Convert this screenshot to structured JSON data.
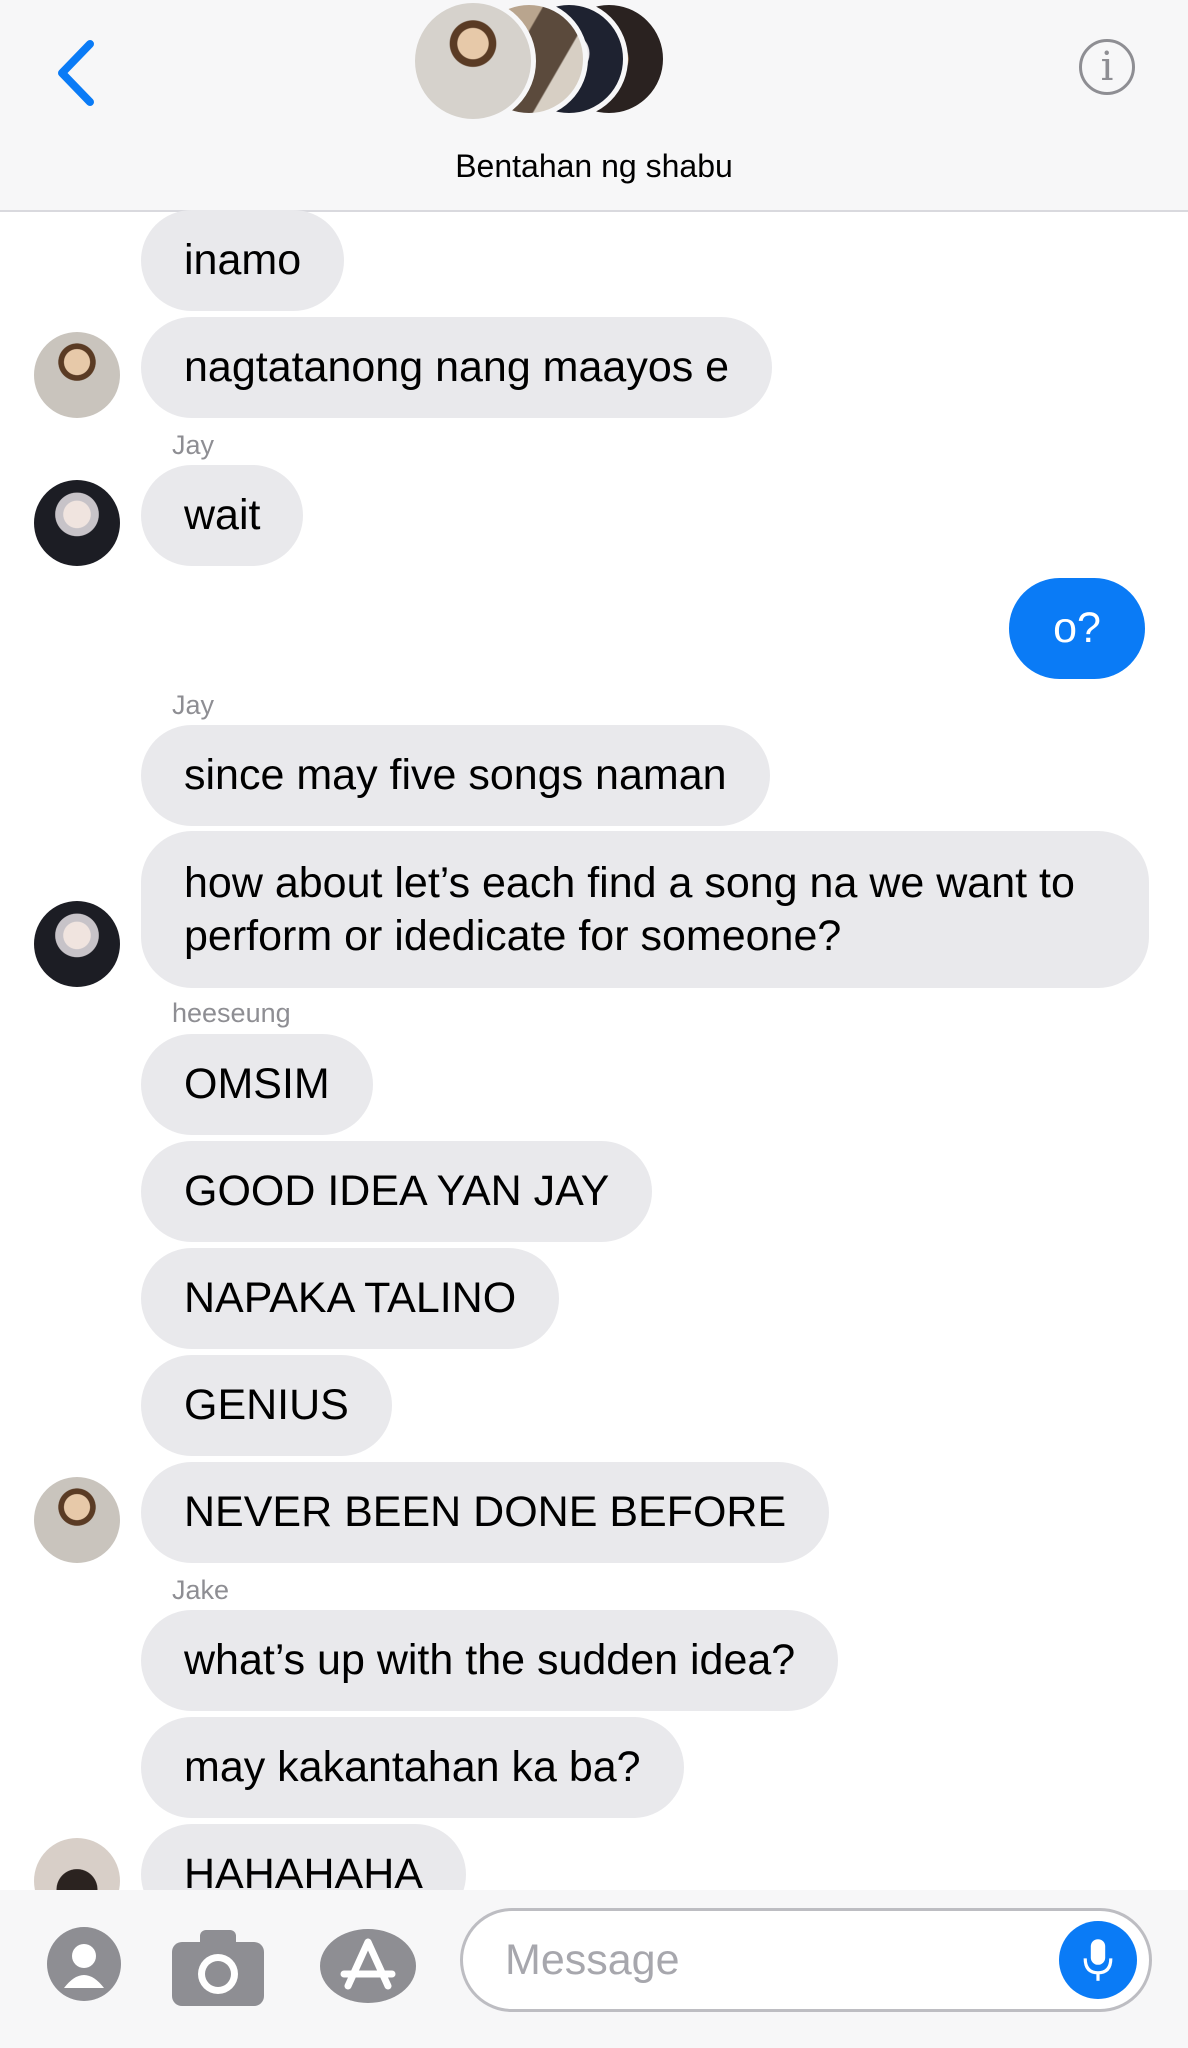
{
  "header": {
    "title": "Bentahan ng shabu",
    "back_icon": "chevron-left-icon",
    "info_icon": "info-icon",
    "info_glyph": "i"
  },
  "messages": [
    {
      "text": "inamo"
    },
    {
      "text": "nagtatanong nang maayos e"
    },
    {
      "sender": "Jay",
      "text": "wait"
    },
    {
      "text": "o?",
      "outgoing": true
    },
    {
      "sender": "Jay",
      "text": "since may five songs naman"
    },
    {
      "text": "how about let’s each find a song na we want to perform or idedicate for someone?"
    },
    {
      "sender": "heeseung",
      "text": "OMSIM"
    },
    {
      "text": "GOOD IDEA YAN JAY"
    },
    {
      "text": "NAPAKA TALINO"
    },
    {
      "text": "GENIUS"
    },
    {
      "text": "NEVER BEEN DONE BEFORE"
    },
    {
      "sender": "Jake",
      "text": "what’s up with the sudden idea?"
    },
    {
      "text": "may kakantahan ka ba?"
    },
    {
      "text": "HAHAHAHA"
    }
  ],
  "composer": {
    "placeholder": "Message",
    "contact_icon": "person-icon",
    "camera_icon": "camera-icon",
    "appstore_icon": "app-store-icon",
    "mic_icon": "microphone-icon"
  },
  "colors": {
    "accent": "#0a7bf6",
    "incoming_bubble": "#e9e9ec",
    "sender_label": "#8e8e93"
  }
}
